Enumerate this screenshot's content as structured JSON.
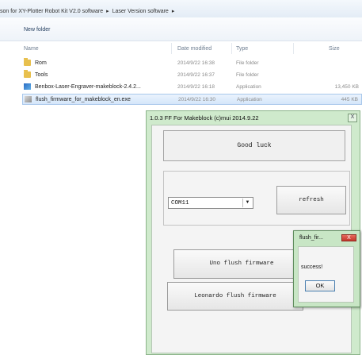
{
  "breadcrumb": {
    "parts": [
      "son for XY-Plotter Robot Kit V2.0 software",
      "Laser Version software"
    ],
    "separator": "▸"
  },
  "toolbar": {
    "new_folder": "New folder"
  },
  "columns": {
    "name": "Name",
    "date": "Date modified",
    "type": "Type",
    "size": "Size"
  },
  "files": [
    {
      "name": "Rom",
      "date": "2014/9/22 16:38",
      "type": "File folder",
      "size": "",
      "icon": "folder-icon"
    },
    {
      "name": "Tools",
      "date": "2014/9/22 16:37",
      "type": "File folder",
      "size": "",
      "icon": "folder-icon"
    },
    {
      "name": "Benbox-Laser-Engraver-makeblock-2.4.2...",
      "date": "2014/9/22 16:18",
      "type": "Application",
      "size": "13,450 KB",
      "icon": "application-icon"
    },
    {
      "name": "flush_firmware_for_makeblock_en.exe",
      "date": "2014/9/22 16:30",
      "type": "Application",
      "size": "445 KB",
      "icon": "flush-app-icon"
    }
  ],
  "app": {
    "title": "1.0.3 FF For Makeblock (c)mui 2014.9.22",
    "close": "X",
    "good_luck": "Good luck",
    "com_port": "COM11",
    "refresh": "refresh",
    "uno_button": "Uno flush firmware",
    "leonardo_button": "Leonardo flush firmware"
  },
  "popup": {
    "title": "flush_fir...",
    "close": "X",
    "message": "success!",
    "ok": "OK"
  },
  "colors": {
    "window_bg": "#cfeacc",
    "popup_close": "#c4372b"
  }
}
